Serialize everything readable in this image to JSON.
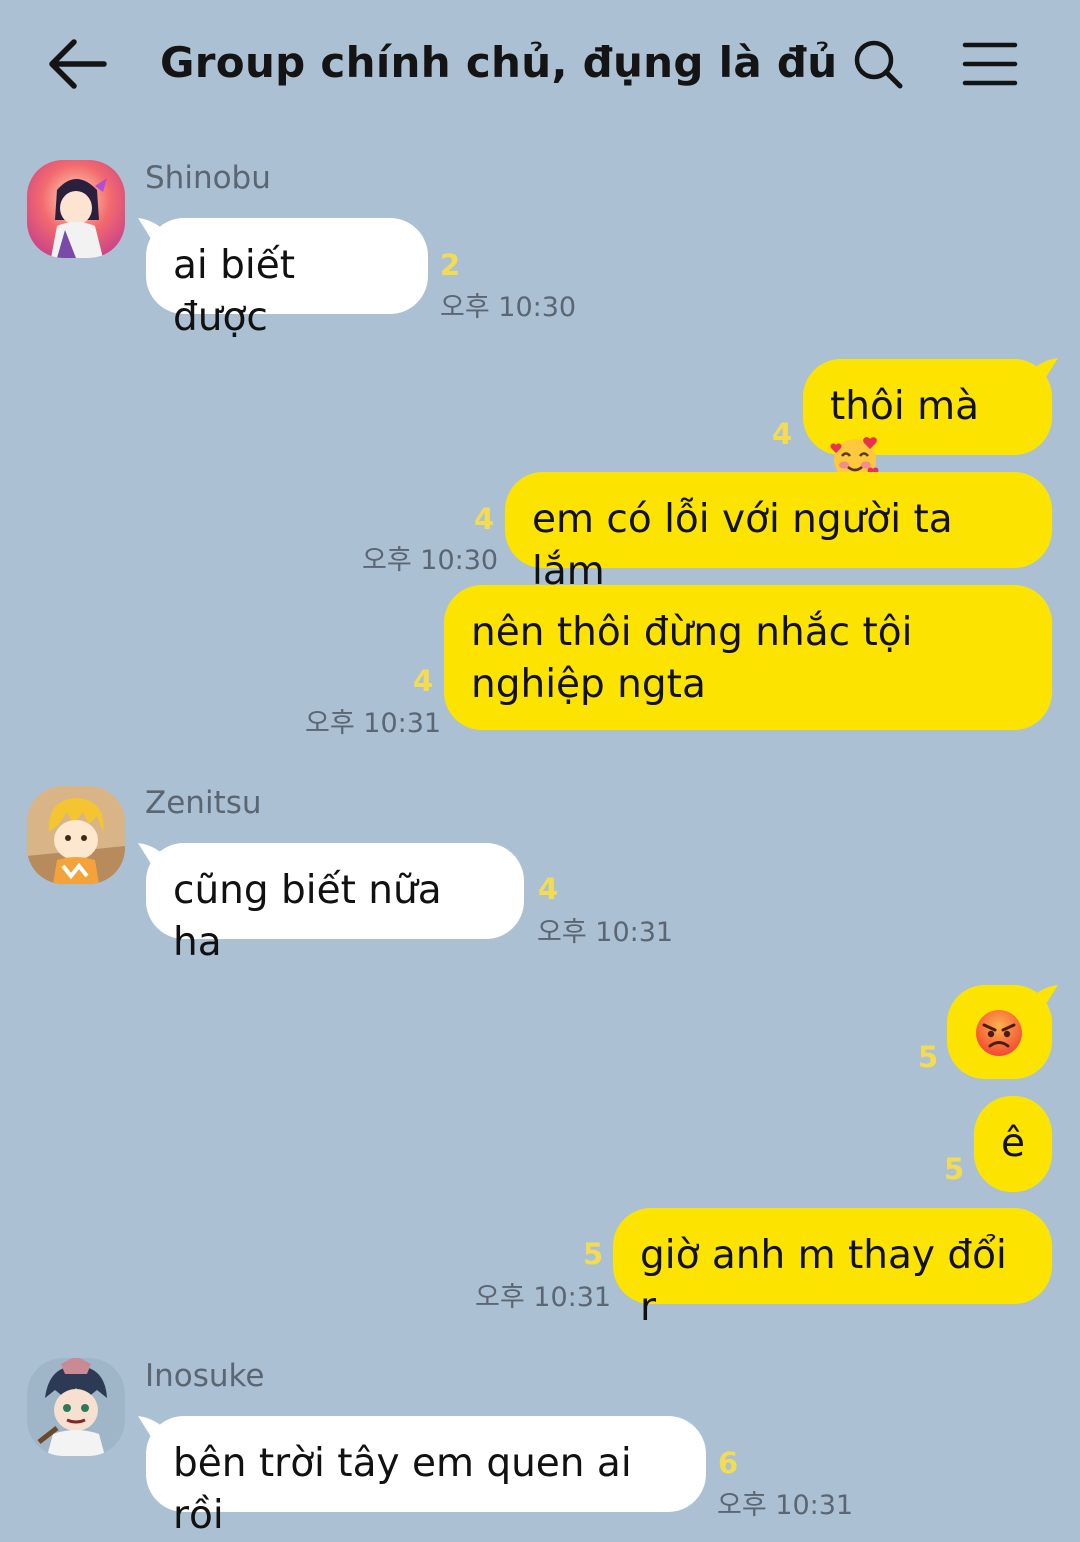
{
  "header": {
    "title": "Group chính chủ, đụng là đủ ..."
  },
  "messages": [
    {
      "sender": "Shinobu",
      "text": "ai biết được",
      "count": "2",
      "time": "오후 10:30"
    },
    {
      "text": "thôi mà",
      "count": "4"
    },
    {
      "text": "em có lỗi với người ta lắm",
      "count": "4",
      "time": "오후 10:30"
    },
    {
      "text": "nên thôi đừng nhắc tội nghiệp ngta",
      "count": "4",
      "time": "오후 10:31"
    },
    {
      "sender": "Zenitsu",
      "text": "cũng biết nữa ha",
      "count": "4",
      "time": "오후 10:31"
    },
    {
      "count": "5"
    },
    {
      "text": "ê",
      "count": "5"
    },
    {
      "text": "giờ anh m thay đổi r",
      "count": "5",
      "time": "오후 10:31"
    },
    {
      "sender": "Inosuke",
      "text": "bên trời tây em quen ai rồi",
      "count": "6",
      "time": "오후 10:31"
    }
  ]
}
